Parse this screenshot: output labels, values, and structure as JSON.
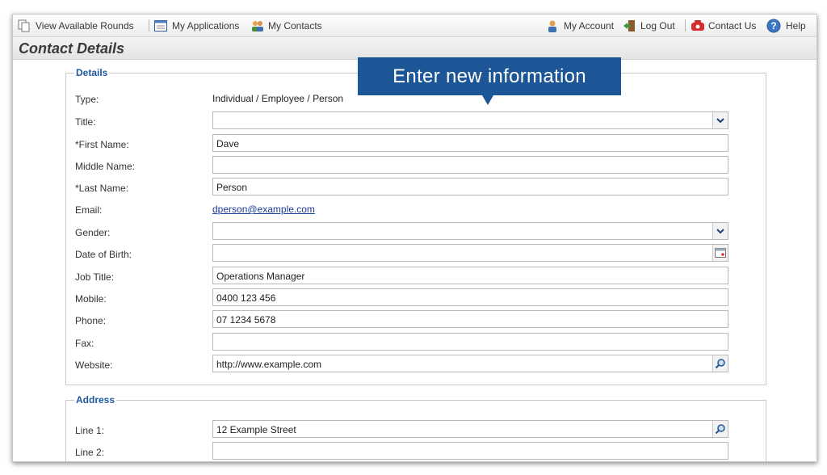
{
  "nav": {
    "view_rounds": "View Available Rounds",
    "my_applications": "My Applications",
    "my_contacts": "My Contacts",
    "my_account": "My Account",
    "log_out": "Log Out",
    "contact_us": "Contact Us",
    "help": "Help"
  },
  "page_title": "Contact Details",
  "callout": "Enter new information",
  "details": {
    "legend": "Details",
    "type_label": "Type:",
    "type_value": "Individual / Employee / Person",
    "title_label": "Title:",
    "title_value": "",
    "first_name_label": "*First Name:",
    "first_name_value": "Dave",
    "middle_name_label": "Middle Name:",
    "middle_name_value": "",
    "last_name_label": "*Last Name:",
    "last_name_value": "Person",
    "email_label": "Email:",
    "email_value": "dperson@example.com",
    "gender_label": "Gender:",
    "gender_value": "",
    "dob_label": "Date of Birth:",
    "dob_value": "",
    "job_title_label": "Job Title:",
    "job_title_value": "Operations Manager",
    "mobile_label": "Mobile:",
    "mobile_value": "0400 123 456",
    "phone_label": "Phone:",
    "phone_value": "07 1234 5678",
    "fax_label": "Fax:",
    "fax_value": "",
    "website_label": "Website:",
    "website_value": "http://www.example.com"
  },
  "address": {
    "legend": "Address",
    "line1_label": "Line 1:",
    "line1_value": "12 Example Street",
    "line2_label": "Line 2:",
    "line2_value": ""
  },
  "colors": {
    "accent": "#1c5696",
    "legend": "#1d5aa0",
    "link": "#1a3c9a"
  }
}
